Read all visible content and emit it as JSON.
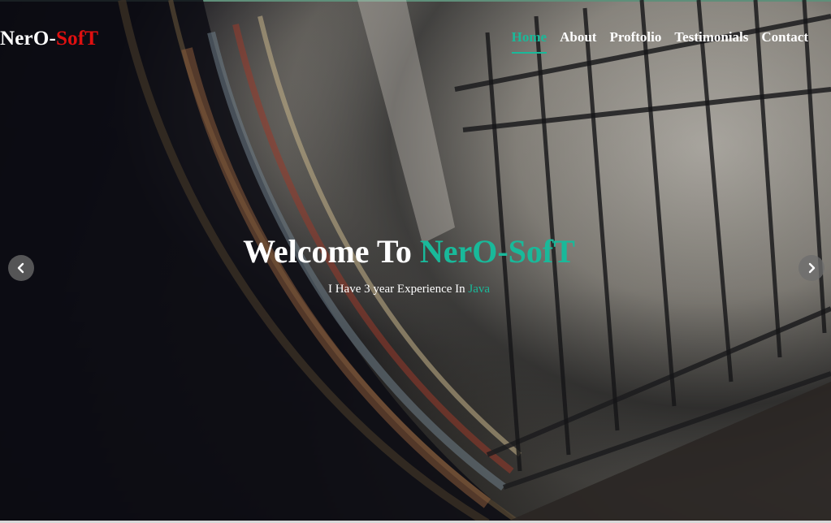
{
  "brand": {
    "part1": "NerO-",
    "part2": "SofT"
  },
  "nav": {
    "items": [
      {
        "label": "Home",
        "active": true
      },
      {
        "label": "About",
        "active": false
      },
      {
        "label": "Proftolio",
        "active": false
      },
      {
        "label": "Testimonials",
        "active": false
      },
      {
        "label": "Contact",
        "active": false
      }
    ]
  },
  "hero": {
    "title_prefix": "Welcome To ",
    "title_accent": "NerO-SofT",
    "subtitle_prefix": "I Have 3 year Experience In ",
    "subtitle_accent": "Java",
    "prev_icon": "chevron-left-icon",
    "next_icon": "chevron-right-icon"
  },
  "colors": {
    "accent": "#19b99a",
    "brand_red": "#e01010",
    "text": "#ffffff"
  }
}
